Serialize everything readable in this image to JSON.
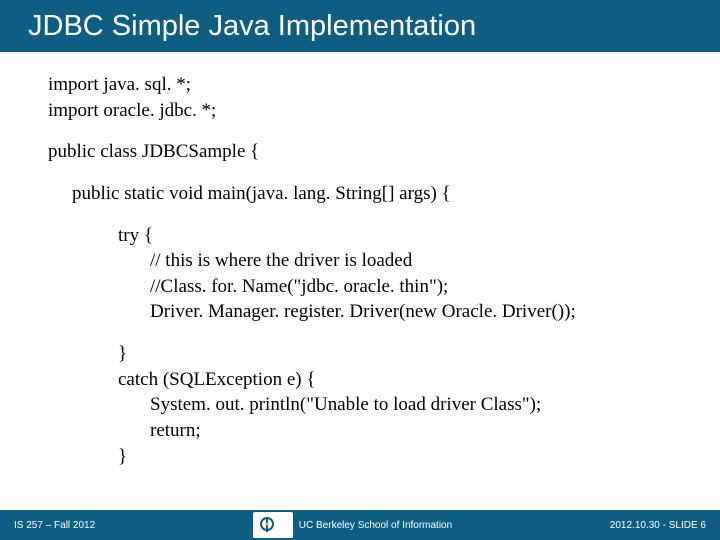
{
  "title": "JDBC Simple Java Implementation",
  "code": {
    "import1": "import java. sql. *;",
    "import2": "import oracle. jdbc. *;",
    "classDecl": "public class JDBCSample {",
    "mainDecl": "public static void main(java. lang. String[] args) {",
    "tryLine": "try {",
    "comment1": "// this is where the driver is loaded",
    "comment2": "//Class. for. Name(\"jdbc. oracle. thin\");",
    "register": "Driver. Manager. register. Driver(new Oracle. Driver());",
    "closeTry": "}",
    "catchLine": "catch (SQLException e) {",
    "println": "System. out. println(\"Unable to load driver Class\");",
    "returnLine": "return;",
    "closeCatch": "}"
  },
  "footer": {
    "left": "IS 257 – Fall 2012",
    "centerText": "UC Berkeley School of Information",
    "right": "2012.10.30 - SLIDE 6"
  }
}
